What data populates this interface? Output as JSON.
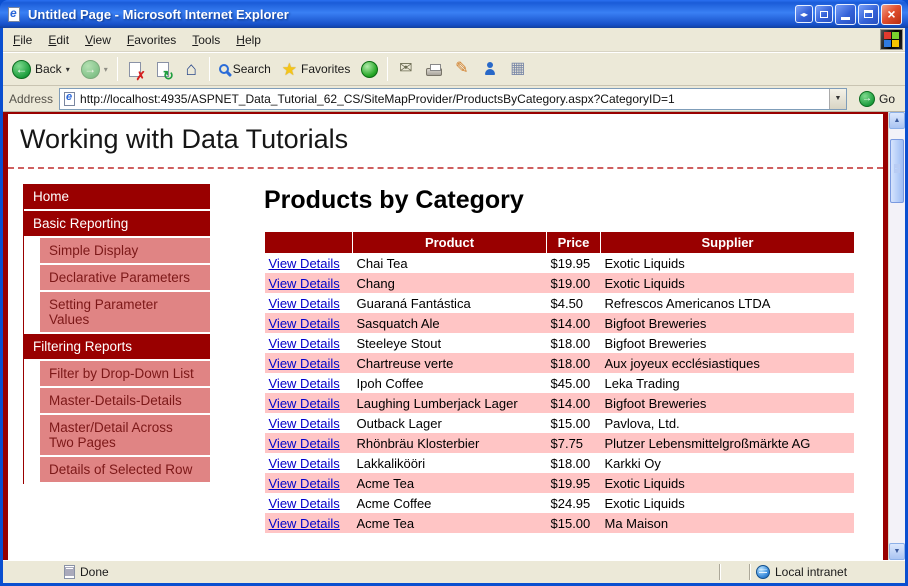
{
  "window": {
    "title": "Untitled Page - Microsoft Internet Explorer",
    "menu_items": [
      "File",
      "Edit",
      "View",
      "Favorites",
      "Tools",
      "Help"
    ],
    "toolbar": {
      "back_label": "Back",
      "search_label": "Search",
      "favorites_label": "Favorites"
    },
    "address": {
      "label": "Address",
      "url": "http://localhost:4935/ASPNET_Data_Tutorial_62_CS/SiteMapProvider/ProductsByCategory.aspx?CategoryID=1",
      "go_label": "Go"
    },
    "status": {
      "left": "Done",
      "zone": "Local intranet"
    }
  },
  "icons": {
    "extra1": "◂▸",
    "close": "×",
    "back": "←",
    "forward": "→",
    "caret": "▾",
    "stop": "✗",
    "refresh": "↻",
    "home": "⌂",
    "favorites_star": "★",
    "mail": "✉",
    "edit": "✎",
    "grid": "▦",
    "go": "→",
    "address_dropdown": "▼",
    "scroll_up": "▲",
    "scroll_down": "▼"
  },
  "page": {
    "banner_title": "Working with Data Tutorials",
    "heading": "Products by Category",
    "sidebar": [
      {
        "label": "Home",
        "level": 1
      },
      {
        "label": "Basic Reporting",
        "level": 1
      },
      {
        "label": "Simple Display",
        "level": 2
      },
      {
        "label": "Declarative Parameters",
        "level": 2
      },
      {
        "label": "Setting Parameter Values",
        "level": 2
      },
      {
        "label": "Filtering Reports",
        "level": 1
      },
      {
        "label": "Filter by Drop-Down List",
        "level": 2
      },
      {
        "label": "Master-Details-Details",
        "level": 2
      },
      {
        "label": "Master/Detail Across Two Pages",
        "level": 2
      },
      {
        "label": "Details of Selected Row",
        "level": 2
      }
    ],
    "table": {
      "link_label": "View Details",
      "columns": [
        "",
        "Product",
        "Price",
        "Supplier"
      ],
      "rows": [
        {
          "product": "Chai Tea",
          "price": "$19.95",
          "supplier": "Exotic Liquids"
        },
        {
          "product": "Chang",
          "price": "$19.00",
          "supplier": "Exotic Liquids"
        },
        {
          "product": "Guaraná Fantástica",
          "price": "$4.50",
          "supplier": "Refrescos Americanos LTDA"
        },
        {
          "product": "Sasquatch Ale",
          "price": "$14.00",
          "supplier": "Bigfoot Breweries"
        },
        {
          "product": "Steeleye Stout",
          "price": "$18.00",
          "supplier": "Bigfoot Breweries"
        },
        {
          "product": "Chartreuse verte",
          "price": "$18.00",
          "supplier": "Aux joyeux ecclésiastiques"
        },
        {
          "product": "Ipoh Coffee",
          "price": "$45.00",
          "supplier": "Leka Trading"
        },
        {
          "product": "Laughing Lumberjack Lager",
          "price": "$14.00",
          "supplier": "Bigfoot Breweries"
        },
        {
          "product": "Outback Lager",
          "price": "$15.00",
          "supplier": "Pavlova, Ltd."
        },
        {
          "product": "Rhönbräu Klosterbier",
          "price": "$7.75",
          "supplier": "Plutzer Lebensmittelgroßmärkte AG"
        },
        {
          "product": "Lakkalikööri",
          "price": "$18.00",
          "supplier": "Karkki Oy"
        },
        {
          "product": "Acme Tea",
          "price": "$19.95",
          "supplier": "Exotic Liquids"
        },
        {
          "product": "Acme Coffee",
          "price": "$24.95",
          "supplier": "Exotic Liquids"
        },
        {
          "product": "Acme Tea",
          "price": "$15.00",
          "supplier": "Ma Maison"
        }
      ]
    }
  },
  "colors": {
    "maroon": "#990000",
    "alt_row_pink": "#ffc5c5",
    "submenu_pink": "#e08484",
    "link_blue": "#0000cc",
    "titlebar_blue": "#1b5cd8",
    "chrome_gray": "#ece9d8"
  }
}
